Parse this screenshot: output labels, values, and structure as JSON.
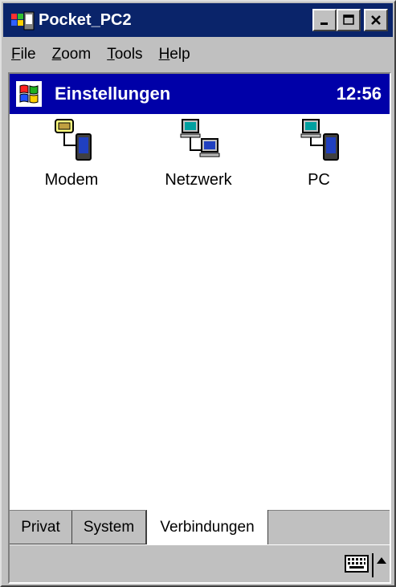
{
  "window": {
    "title": "Pocket_PC2",
    "buttons": [
      "minimize",
      "maximize",
      "close"
    ]
  },
  "menubar": {
    "items": [
      {
        "label": "File",
        "underline": "F",
        "rest": "ile"
      },
      {
        "label": "Zoom",
        "underline": "Z",
        "rest": "oom"
      },
      {
        "label": "Tools",
        "underline": "T",
        "rest": "ools"
      },
      {
        "label": "Help",
        "underline": "H",
        "rest": "elp"
      }
    ]
  },
  "navbar": {
    "title": "Einstellungen",
    "time": "12:56",
    "start_icon": "windows-flag-icon"
  },
  "items": [
    {
      "label": "Modem",
      "icon": "modem-icon"
    },
    {
      "label": "Netzwerk",
      "icon": "network-icon"
    },
    {
      "label": "PC",
      "icon": "pc-sync-icon"
    }
  ],
  "tabs": [
    {
      "label": "Privat",
      "active": false
    },
    {
      "label": "System",
      "active": false
    },
    {
      "label": "Verbindungen",
      "active": true
    }
  ],
  "cmdbar": {
    "keyboard_icon": "keyboard-icon",
    "sip_arrow": "sip-up-arrow-icon"
  },
  "colors": {
    "titlebar": "#0a246a",
    "navbar": "#0000a8",
    "chrome": "#c0c0c0"
  }
}
